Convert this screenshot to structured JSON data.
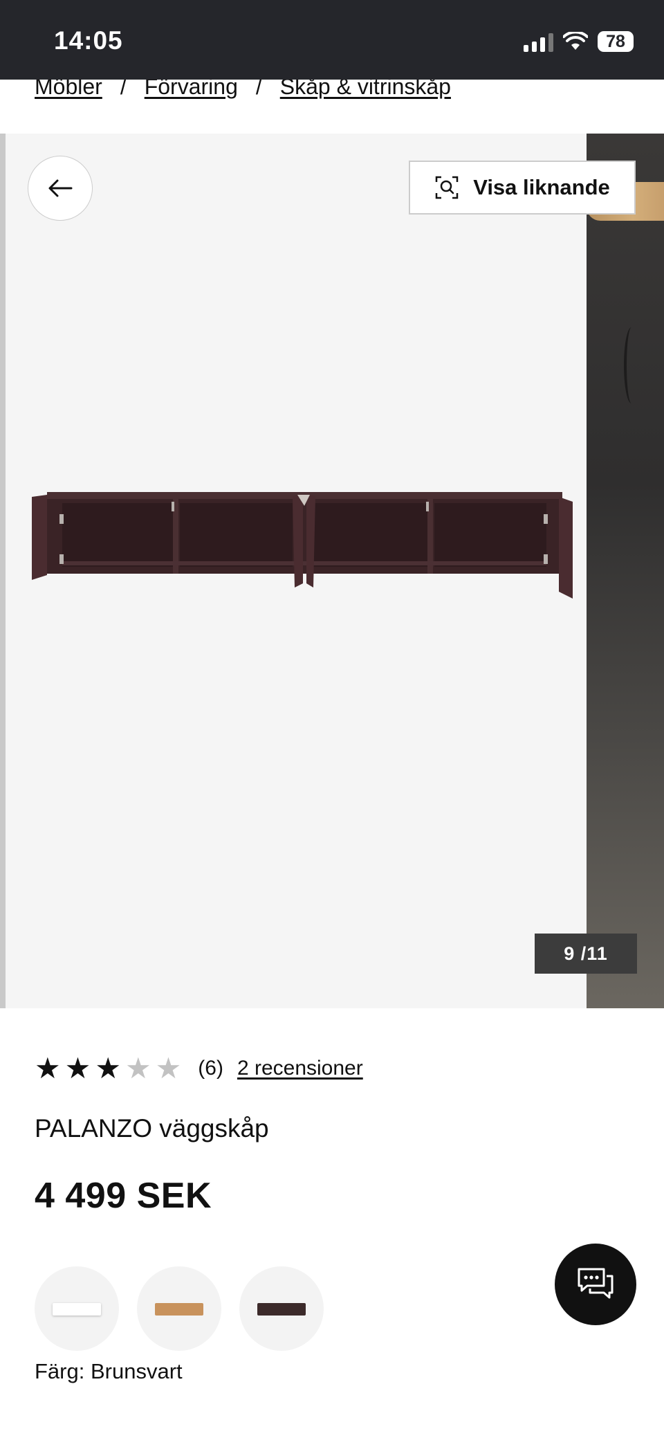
{
  "status_bar": {
    "time": "14:05",
    "battery": "78"
  },
  "breadcrumb": {
    "items": [
      "Möbler",
      "Förvaring",
      "Skåp & vitrinskåp"
    ],
    "separator": "/"
  },
  "gallery": {
    "similar_label": "Visa liknande",
    "counter": "9 /11"
  },
  "product": {
    "rating": 3,
    "rating_max": 5,
    "rating_count": "(6)",
    "reviews_link": "2 recensioner",
    "title": "PALANZO väggskåp",
    "price": "4 499 SEK",
    "color_label": "Färg: Brunsvart"
  },
  "swatches": [
    {
      "name": "white",
      "color": "#ffffff"
    },
    {
      "name": "oak",
      "color": "#c8925c"
    },
    {
      "name": "brown-black",
      "color": "#3c2a2a"
    }
  ],
  "colors": {
    "status_bar": "#25262b",
    "cabinet": "#3a2326"
  }
}
